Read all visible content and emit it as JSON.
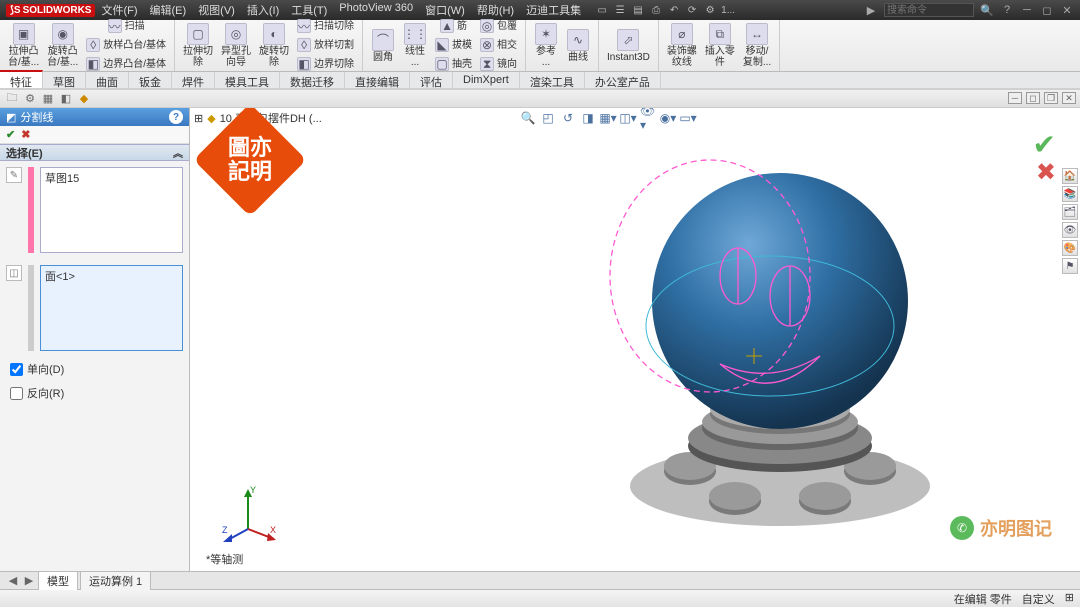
{
  "app": {
    "name": "SOLIDWORKS"
  },
  "menu": [
    "文件(F)",
    "编辑(E)",
    "视图(V)",
    "插入(I)",
    "工具(T)",
    "PhotoView 360",
    "窗口(W)",
    "帮助(H)",
    "迈迪工具集"
  ],
  "search_placeholder": "搜索命令",
  "qat_extra": "1...",
  "ribbon_tabs": [
    "特征",
    "草图",
    "曲面",
    "钣金",
    "焊件",
    "模具工具",
    "数据迁移",
    "直接编辑",
    "评估",
    "DimXpert",
    "渲染工具",
    "办公室产品"
  ],
  "ribbon_buttons": [
    {
      "l": "拉伸凸\n台/基..."
    },
    {
      "l": "旋转凸\n台/基..."
    },
    {
      "l": "扫描"
    },
    {
      "l": "放样凸台/基体"
    },
    {
      "l": "边界凸台/基体"
    },
    {
      "l": "拉伸切\n除"
    },
    {
      "l": "异型孔\n向导"
    },
    {
      "l": "旋转切\n除"
    },
    {
      "l": "扫描切除"
    },
    {
      "l": "放样切割"
    },
    {
      "l": "边界切除"
    },
    {
      "l": "圆角"
    },
    {
      "l": "线性\n..."
    },
    {
      "l": "筋"
    },
    {
      "l": "拔模"
    },
    {
      "l": "抽壳"
    },
    {
      "l": "包覆"
    },
    {
      "l": "相交"
    },
    {
      "l": "镜向"
    },
    {
      "l": "参考\n..."
    },
    {
      "l": "曲线"
    },
    {
      "l": "Instant3D"
    },
    {
      "l": "装饰螺\n纹线"
    },
    {
      "l": "插入零\n件"
    },
    {
      "l": "移动/\n复制..."
    }
  ],
  "pm": {
    "title": "分割线",
    "section": "选择(E)",
    "sketch_item": "草图15",
    "face_item": "面<1>",
    "chk_single": "单向(D)",
    "chk_reverse": "反向(R)"
  },
  "document_title": "10.表情包摆件DH   (...",
  "triad_label": "*等轴测",
  "bottom_tabs": {
    "model": "模型",
    "motion": "运动算例 1"
  },
  "status": {
    "left": "",
    "edit": "在编辑 零件",
    "sys": "自定义"
  },
  "watermark_text": "圖亦\n記明",
  "wm_brand": "亦明图记"
}
